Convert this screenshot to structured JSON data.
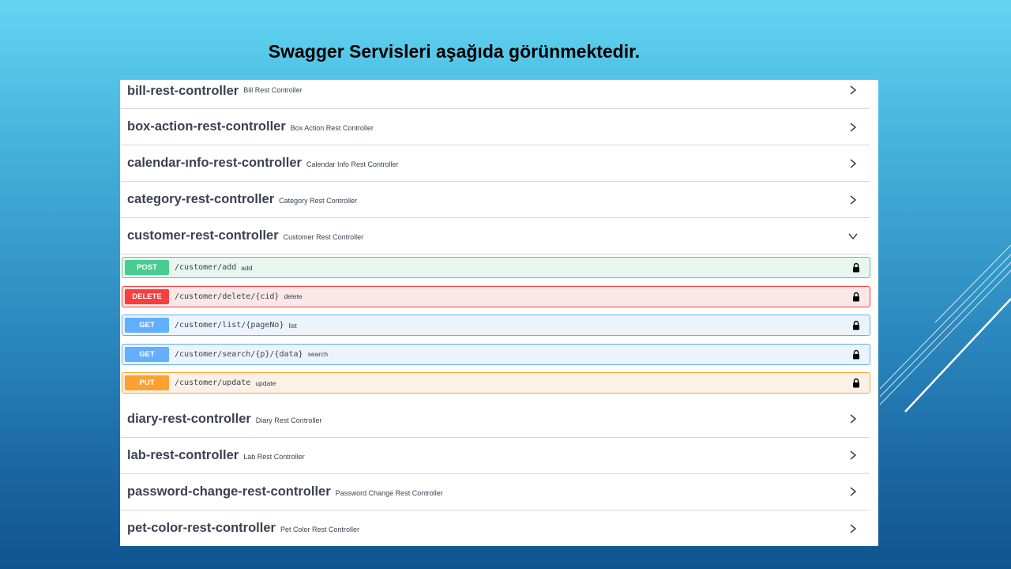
{
  "slide": {
    "title": "Swagger Servisleri aşağıda görünmektedir."
  },
  "tags_top": [
    {
      "name": "bill-rest-controller",
      "desc": "Bill Rest Controller",
      "icon": "chevron-right-icon"
    },
    {
      "name": "box-action-rest-controller",
      "desc": "Box Action Rest Controller",
      "icon": "chevron-right-icon"
    },
    {
      "name": "calendar-ınfo-rest-controller",
      "desc": "Calendar Info Rest Controller",
      "icon": "chevron-right-icon"
    },
    {
      "name": "category-rest-controller",
      "desc": "Category Rest Controller",
      "icon": "chevron-right-icon"
    },
    {
      "name": "customer-rest-controller",
      "desc": "Customer Rest Controller",
      "icon": "chevron-down-icon"
    }
  ],
  "operations": [
    {
      "method": "POST",
      "path": "/customer/add",
      "summary": "add",
      "color": "#49cc90"
    },
    {
      "method": "DELETE",
      "path": "/customer/delete/{cid}",
      "summary": "delete",
      "color": "#f93e3e"
    },
    {
      "method": "GET",
      "path": "/customer/list/{pageNo}",
      "summary": "list",
      "color": "#61affe"
    },
    {
      "method": "GET",
      "path": "/customer/search/{p}/{data}",
      "summary": "search",
      "color": "#61affe"
    },
    {
      "method": "PUT",
      "path": "/customer/update",
      "summary": "update",
      "color": "#fca130"
    }
  ],
  "tags_bottom": [
    {
      "name": "diary-rest-controller",
      "desc": "Diary Rest Controller",
      "icon": "chevron-right-icon"
    },
    {
      "name": "lab-rest-controller",
      "desc": "Lab Rest Controller",
      "icon": "chevron-right-icon"
    },
    {
      "name": "password-change-rest-controller",
      "desc": "Password Change Rest Controller",
      "icon": "chevron-right-icon"
    },
    {
      "name": "pet-color-rest-controller",
      "desc": "Pet Color Rest Controller",
      "icon": "chevron-right-icon"
    }
  ],
  "colors": {
    "text": "#3b4151",
    "divider": "#d6d6d6"
  }
}
